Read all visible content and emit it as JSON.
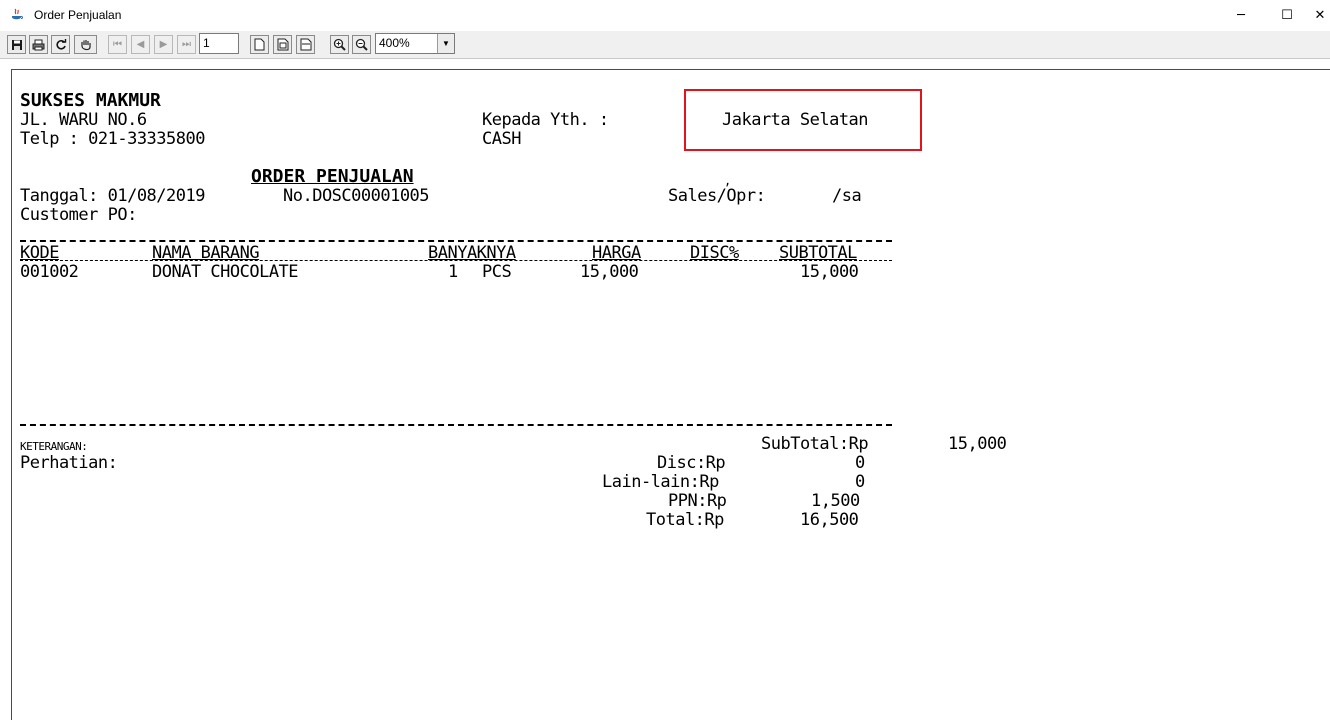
{
  "window": {
    "title": "Order Penjualan",
    "minimize": "─",
    "maximize": "☐",
    "close": "✕"
  },
  "toolbar": {
    "page_value": "1",
    "zoom_value": "400%",
    "icons": [
      "save-icon",
      "print-icon",
      "refresh-icon",
      "hand-icon",
      "first-page-icon",
      "prev-page-icon",
      "next-page-icon",
      "last-page-icon",
      "actual-size-icon",
      "fit-page-icon",
      "fit-width-icon",
      "zoom-in-icon",
      "zoom-out-icon"
    ]
  },
  "report": {
    "company": "SUKSES MAKMUR",
    "address": "JL. WARU NO.6",
    "phone": "Telp : 021-33335800",
    "to_label": "Kepada Yth. :",
    "to_value": "CASH",
    "city": "Jakarta Selatan",
    "doc_title": "ORDER PENJUALAN",
    "date": "Tanggal: 01/08/2019",
    "number": "No.DOSC00001005",
    "comma": ",",
    "sales": "Sales/Opr:",
    "sales_value": "/sa",
    "customer_po": "Customer PO:",
    "columns": {
      "kode": "KODE",
      "nama": "NAMA BARANG",
      "banyak": "BANYAKNYA",
      "harga": "HARGA",
      "disc": "DISC%",
      "subtotal": "SUBTOTAL"
    },
    "rows": [
      {
        "kode": "001002",
        "nama": "DONAT CHOCOLATE",
        "qty": "1",
        "unit": "PCS",
        "harga": "15,000",
        "subtotal": "15,000"
      }
    ],
    "keterangan": "KETERANGAN:",
    "perhatian": "Perhatian:",
    "subtotal_label": "SubTotal:Rp",
    "subtotal_value": "15,000",
    "disc_label": "Disc:Rp",
    "disc_value": "0",
    "lain_label": "Lain-lain:Rp",
    "lain_value": "0",
    "ppn_label": "PPN:Rp",
    "ppn_value": "1,500",
    "total_label": "Total:Rp",
    "total_value": "16,500"
  },
  "colors": {
    "highlight_box": "#e0141e"
  }
}
